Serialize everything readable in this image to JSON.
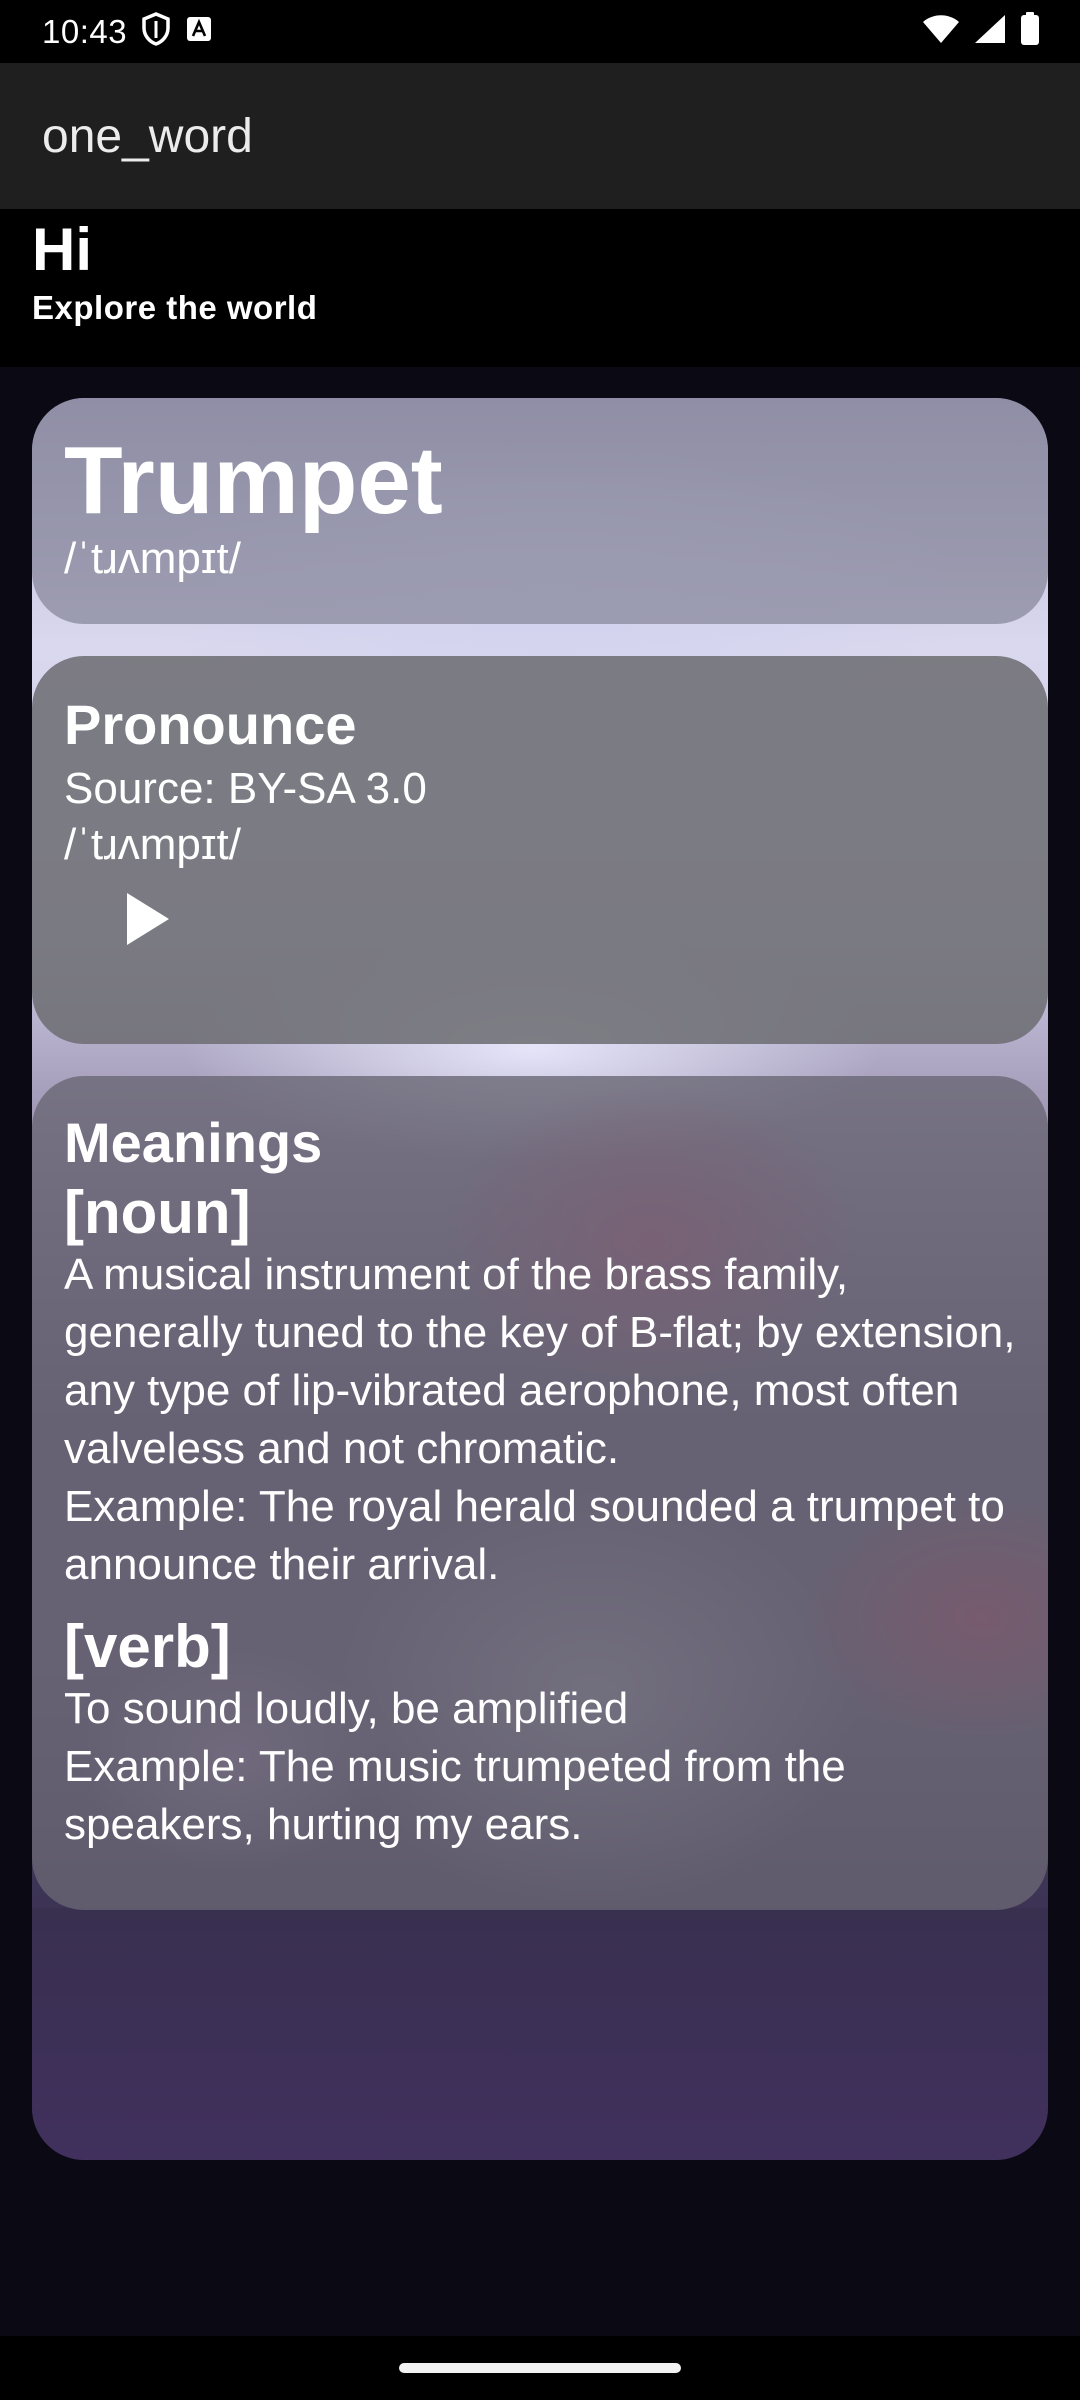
{
  "status_bar": {
    "time": "10:43"
  },
  "app_bar": {
    "title": "one_word"
  },
  "greeting": {
    "title": "Hi",
    "subtitle": "Explore the world"
  },
  "word_card": {
    "word": "Trumpet",
    "phonetic": "/ˈtɹʌmpɪt/"
  },
  "pronounce_card": {
    "title": "Pronounce",
    "source": "Source: BY-SA 3.0",
    "phonetic": "/ˈtɹʌmpɪt/"
  },
  "meanings_card": {
    "title": "Meanings",
    "items": [
      {
        "part_of_speech": "[noun]",
        "definition": "A musical instrument of the brass family, generally tuned to the key of B-flat; by extension, any type of lip-vibrated aerophone, most often valveless and not chromatic.",
        "example": "Example: The royal herald sounded a trumpet to announce their arrival."
      },
      {
        "part_of_speech": "[verb]",
        "definition": "To sound loudly, be amplified",
        "example": "Example: The music trumpeted from the speakers, hurting my ears."
      }
    ]
  },
  "icons": {
    "shield": "shield-icon",
    "notification": "a-notification-icon",
    "wifi": "wifi-icon",
    "signal": "signal-icon",
    "battery": "battery-icon",
    "play": "play-icon"
  }
}
